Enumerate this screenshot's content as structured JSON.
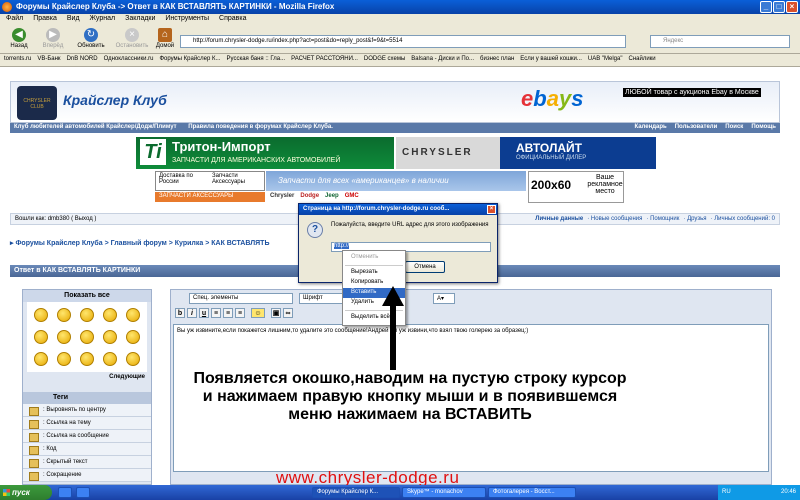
{
  "window": {
    "title": "Форумы Крайслер Клуба -> Ответ в КАК ВСТАВЛЯТЬ КАРТИНКИ - Mozilla Firefox"
  },
  "menu": [
    "Файл",
    "Правка",
    "Вид",
    "Журнал",
    "Закладки",
    "Инструменты",
    "Справка"
  ],
  "nav": {
    "back": "Назад",
    "forward": "Вперёд",
    "reload": "Обновить",
    "stop": "Остановить",
    "home": "Домой",
    "url": "http://forum.chrysler-dodge.ru/index.php?act=post&do=reply_post&f=9&t=5514",
    "search_placeholder": "Яндекс"
  },
  "bookmarks": [
    "torrents.ru",
    "VB-Банк",
    "DnB NORD",
    "Одноклассники.ru",
    "Форумы Крайслер К...",
    "Русская баня :: Гла...",
    "РАСЧЕТ РАССТОЯНИ...",
    "DODGE схемы",
    "Balsana - Диски и По...",
    "бизнес план",
    "Если у вашей кошки...",
    "UAB \"Melga\"",
    "Снайлики"
  ],
  "site": {
    "name": "Крайслер Клуб",
    "ebay": "ebay",
    "ebay_ad": "ЛЮБОЙ товар с аукциона Ebay в Москве",
    "subtitle": "Клуб любителей автомобилей Крайслер/Додж/Плимут",
    "rules": "Правила поведения в форумах Крайслер Клуба.",
    "links": [
      "Календарь",
      "Пользователи",
      "Поиск",
      "Помощь"
    ]
  },
  "ads": {
    "triton": "Тритон-Импорт",
    "triton_sub": "ЗАПЧАСТИ ДЛЯ АМЕРИКАНСКИХ АВТОМОБИЛЕЙ",
    "chrysler": "CHRYSLER",
    "avtolait": "АВТОЛАЙТ",
    "avtolait_sub": "ОФИЦИАЛЬНЫЙ ДИЛЕР",
    "delivery": "Доставка по России",
    "parts": "Запчасти Аксессуары",
    "american": "Запчасти для всех «американцев» в наличии",
    "size": "200x60",
    "size_sub": "Ваше рекламное место",
    "accessories": "ЗАПЧАСТИ   АКСЕССУАРЫ",
    "brands": [
      "Chrysler",
      "Dodge",
      "Jeep",
      "GMC"
    ]
  },
  "login": {
    "text": "Вошли как: dmb380 ( Выход )",
    "links": [
      "Личные данные",
      "· Новые сообщения",
      "· Помощник",
      "· Друзья",
      "· Личных сообщений: 0"
    ]
  },
  "breadcrumb": "▸ Форумы Крайслер Клуба > Главный форум > Курилка > КАК ВСТАВЛЯТЬ",
  "reply_header": "Ответ в КАК ВСТАВЛЯТЬ КАРТИНКИ",
  "smilies": {
    "show_all": "Показать все",
    "next": "Следующие"
  },
  "tags": {
    "header": "Теги",
    "items": [
      ": Выровнять по центру",
      ": Ссылка на тему",
      ": Ссылка на сообщение",
      ": Код",
      ": Скрытый текст",
      ": Сокращение"
    ]
  },
  "editor": {
    "special": "Спец. элементы",
    "font": "Шрифт",
    "text": "Вы уж извините,если покажется лишним,то удалите это сообщение!Андрей ты уж извини,что взял твою голерею за образец:)"
  },
  "dialog": {
    "title": "Страница на http://forum.chrysler-dodge.ru сооб...",
    "prompt": "Пожалуйста, введите URL адрес для этого изображения",
    "value": "http://",
    "ok": "OK",
    "cancel": "Отмена"
  },
  "context_menu": {
    "undo": "Отменить",
    "cut": "Вырезать",
    "copy": "Копировать",
    "paste": "Вставить",
    "delete": "Удалить",
    "select_all": "Выделить всё"
  },
  "caption": "Появляется окошко,наводим на пустую строку курсор и нажимаем правую кнопку мыши и в появившемся меню нажимаем на ВСТАВИТЬ",
  "watermark": "www.chrysler-dodge.ru",
  "taskbar": {
    "start": "пуск",
    "tasks": [
      "",
      "",
      "Форумы Крайслер К...",
      "Skype™ - monachov",
      "Фотогалерея - Восст..."
    ],
    "lang": "RU",
    "time": "20:46"
  }
}
